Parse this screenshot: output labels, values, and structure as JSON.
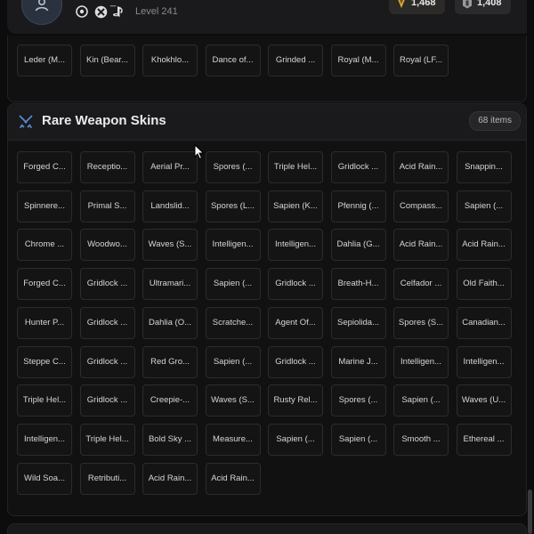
{
  "header": {
    "username_fragment": "_",
    "level": "Level 241",
    "platforms": [
      "ubisoft-icon",
      "xbox-icon",
      "playstation-icon"
    ],
    "currencies": [
      {
        "name": "renown-coins",
        "value": "1,468",
        "color": "#e4b43a"
      },
      {
        "name": "r6-credits",
        "value": "1,408",
        "color": "#9a9a9a"
      }
    ]
  },
  "top_section": {
    "items": [
      "Leder (M...",
      "Kin (Bear...",
      "Khokhlo...",
      "Dance of...",
      "Grinded ...",
      "Royal (M...",
      "Royal (LF..."
    ]
  },
  "rare_section": {
    "title": "Rare Weapon Skins",
    "count": "68 items",
    "accent": "#5b8ad6",
    "items": [
      "Forged C...",
      "Receptio...",
      "Aerial Pr...",
      "Spores (...",
      "Triple Hel...",
      "Gridlock ...",
      "Acid Rain...",
      "Snappin...",
      "Spinnere...",
      "Primal S...",
      "Landslid...",
      "Spores (L...",
      "Sapien (K...",
      "Pfennig (...",
      "Compass...",
      "Sapien (...",
      "Chrome ...",
      "Woodwo...",
      "Waves (S...",
      "Intelligen...",
      "Intelligen...",
      "Dahlia (G...",
      "Acid Rain...",
      "Acid Rain...",
      "Forged C...",
      "Gridlock ...",
      "Ultramari...",
      "Sapien (...",
      "Gridlock ...",
      "Breath-H...",
      "Celfador ...",
      "Old Faith...",
      "Hunter P...",
      "Gridlock ...",
      "Dahlia (O...",
      "Scratche...",
      "Agent Of...",
      "Sepiolida...",
      "Spores (S...",
      "Canadian...",
      "Steppe C...",
      "Gridlock ...",
      "Red Gro...",
      "Sapien (...",
      "Gridlock ...",
      "Marine J...",
      "Intelligen...",
      "Intelligen...",
      "Triple Hel...",
      "Gridlock ...",
      "Creepie-...",
      "Waves (S...",
      "Rusty Rel...",
      "Spores (...",
      "Sapien (...",
      "Waves (U...",
      "Intelligen...",
      "Triple Hel...",
      "Bold Sky ...",
      "Measure...",
      "Sapien (...",
      "Sapien (...",
      "Smooth ...",
      "Ethereal ...",
      "Wild Soa...",
      "Retributi...",
      "Acid Rain...",
      "Acid Rain..."
    ]
  }
}
